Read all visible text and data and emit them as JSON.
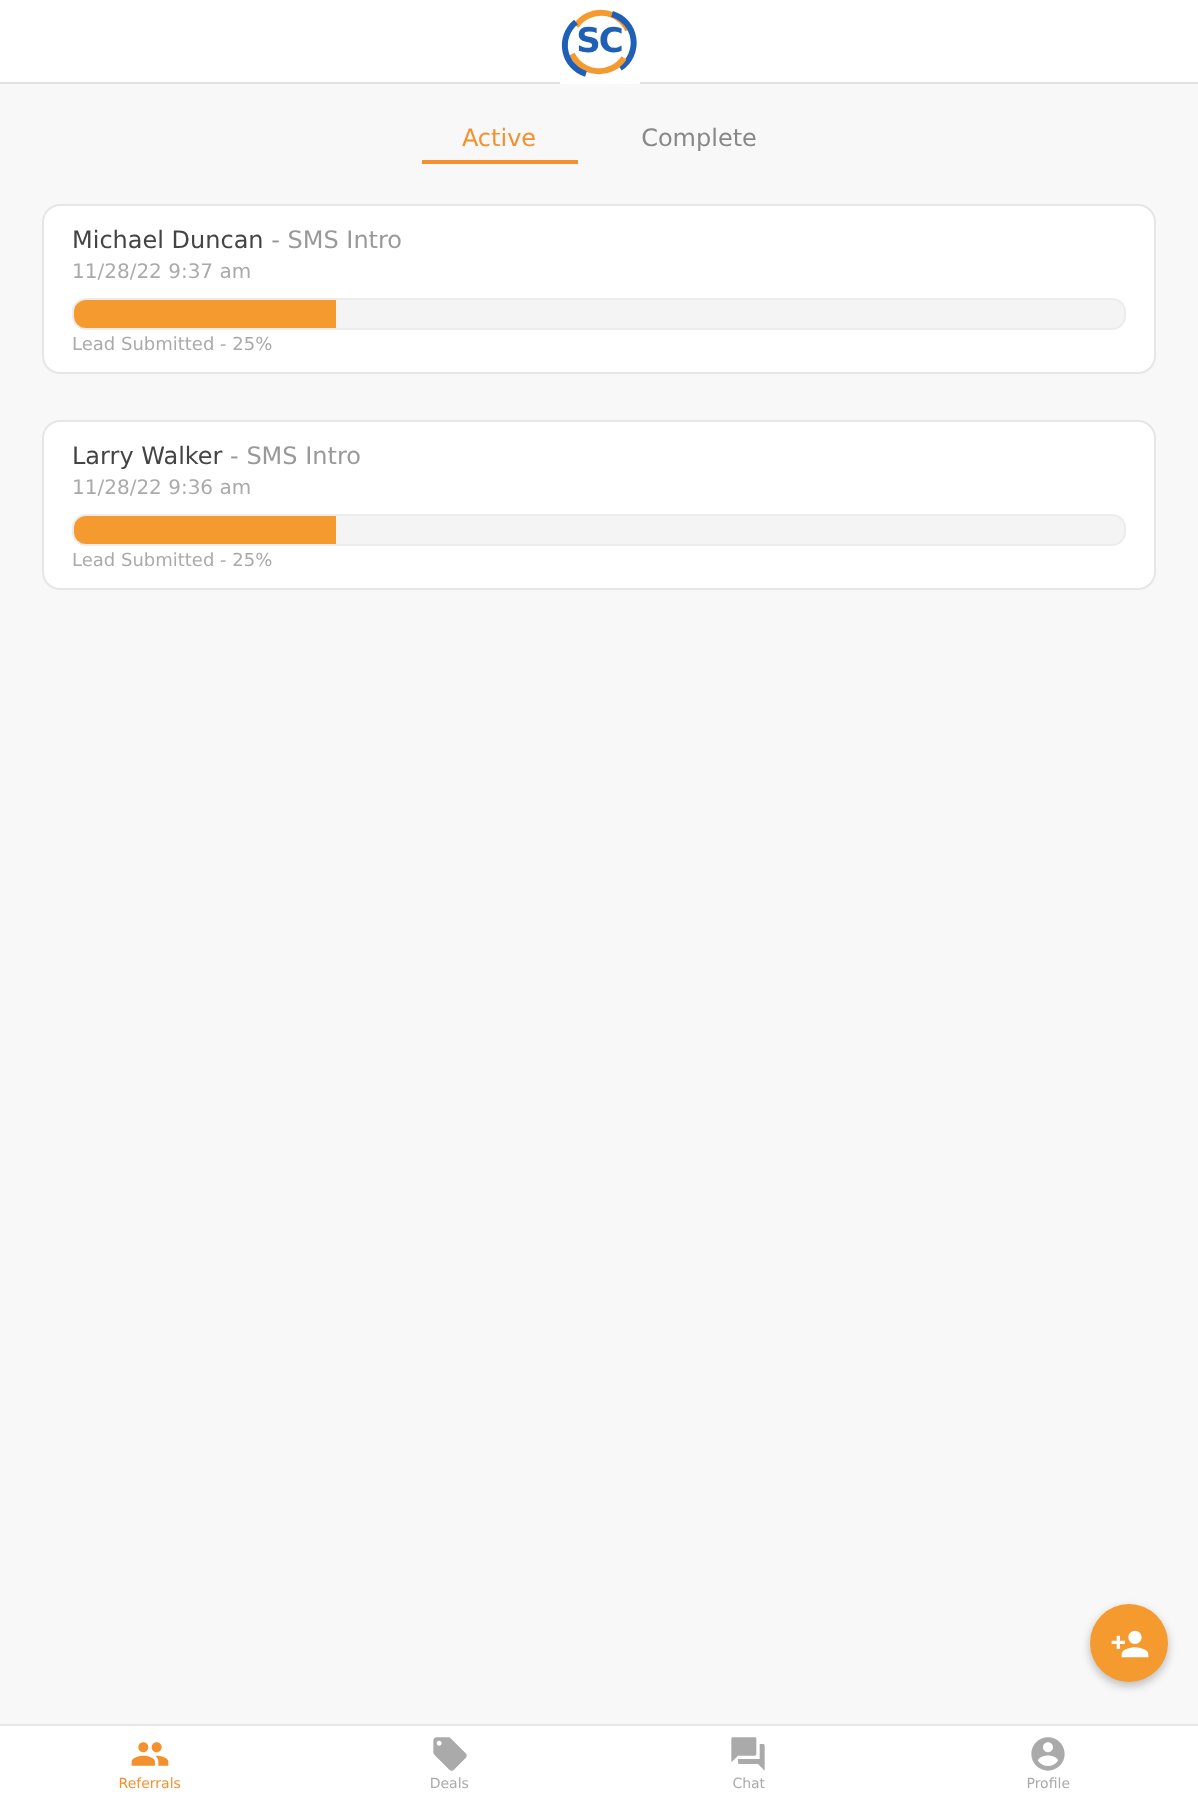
{
  "logo": {
    "letters": "SC"
  },
  "tabs": [
    {
      "label": "Active",
      "selected": true
    },
    {
      "label": "Complete",
      "selected": false
    }
  ],
  "referrals": [
    {
      "name": "Michael Duncan",
      "campaign": " - SMS Intro",
      "date": "11/28/22 9:37 am",
      "level": 0.25,
      "status": "Lead Submitted - 25%"
    },
    {
      "name": "Larry Walker",
      "campaign": " - SMS Intro",
      "date": "11/28/22 9:36 am",
      "level": 0.25,
      "status": "Lead Submitted - 25%"
    }
  ],
  "nav": [
    {
      "label": "Referrals",
      "kind": "people",
      "selected": true
    },
    {
      "label": "Deals",
      "kind": "tag",
      "selected": false
    },
    {
      "label": "Chat",
      "kind": "chat",
      "selected": false
    },
    {
      "label": "Profile",
      "kind": "person",
      "selected": false
    }
  ]
}
